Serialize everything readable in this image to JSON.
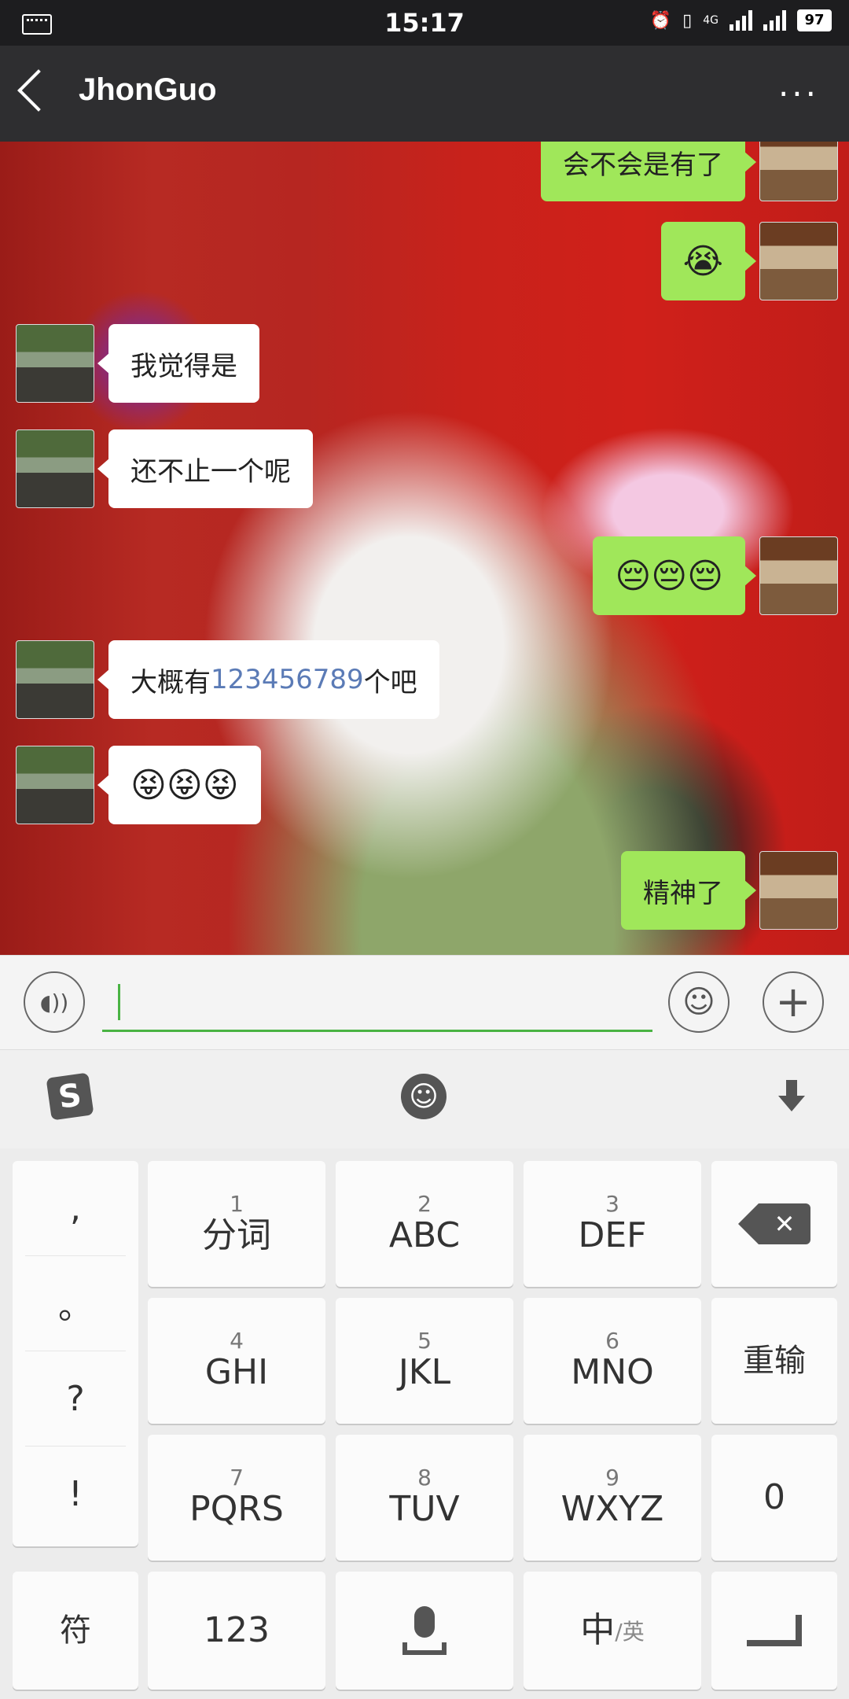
{
  "status_bar": {
    "time": "15:17",
    "network": "4G",
    "battery": "97"
  },
  "header": {
    "title": "JhonGuo",
    "more": "···"
  },
  "messages": [
    {
      "side": "right",
      "text": "会不会是有了"
    },
    {
      "side": "right",
      "text": "😭"
    },
    {
      "side": "left",
      "text": "我觉得是"
    },
    {
      "side": "left",
      "text": "还不止一个呢"
    },
    {
      "side": "right",
      "text": "😔😔😔"
    },
    {
      "side": "left",
      "text_before": "大概有 ",
      "number": "123456789",
      "text_after": " 个吧"
    },
    {
      "side": "left",
      "text": "😝😝😝"
    },
    {
      "side": "right",
      "text": "精神了"
    }
  ],
  "input": {
    "value": ""
  },
  "keyboard": {
    "punct": [
      ",",
      "。",
      "?",
      "!"
    ],
    "keys": [
      {
        "n": "1",
        "l": "分词"
      },
      {
        "n": "2",
        "l": "ABC"
      },
      {
        "n": "3",
        "l": "DEF"
      },
      {
        "n": "4",
        "l": "GHI"
      },
      {
        "n": "5",
        "l": "JKL"
      },
      {
        "n": "6",
        "l": "MNO"
      },
      {
        "n": "7",
        "l": "PQRS"
      },
      {
        "n": "8",
        "l": "TUV"
      },
      {
        "n": "9",
        "l": "WXYZ"
      }
    ],
    "reinput": "重输",
    "zero": "0",
    "symbols": "符",
    "numbers": "123",
    "lang_main": "中",
    "lang_alt": "/英"
  },
  "colors": {
    "my_bubble": "#a0e75a",
    "accent": "#49b343",
    "header": "#2e2e30"
  },
  "icons": [
    "keyboard-icon",
    "alarm-icon",
    "vibrate-icon",
    "signal-icon",
    "battery-icon",
    "back-icon",
    "more-icon",
    "voice-icon",
    "emoji-icon",
    "plus-icon",
    "sogou-logo-icon",
    "hide-keyboard-icon",
    "backspace-icon",
    "mic-icon",
    "enter-icon"
  ]
}
